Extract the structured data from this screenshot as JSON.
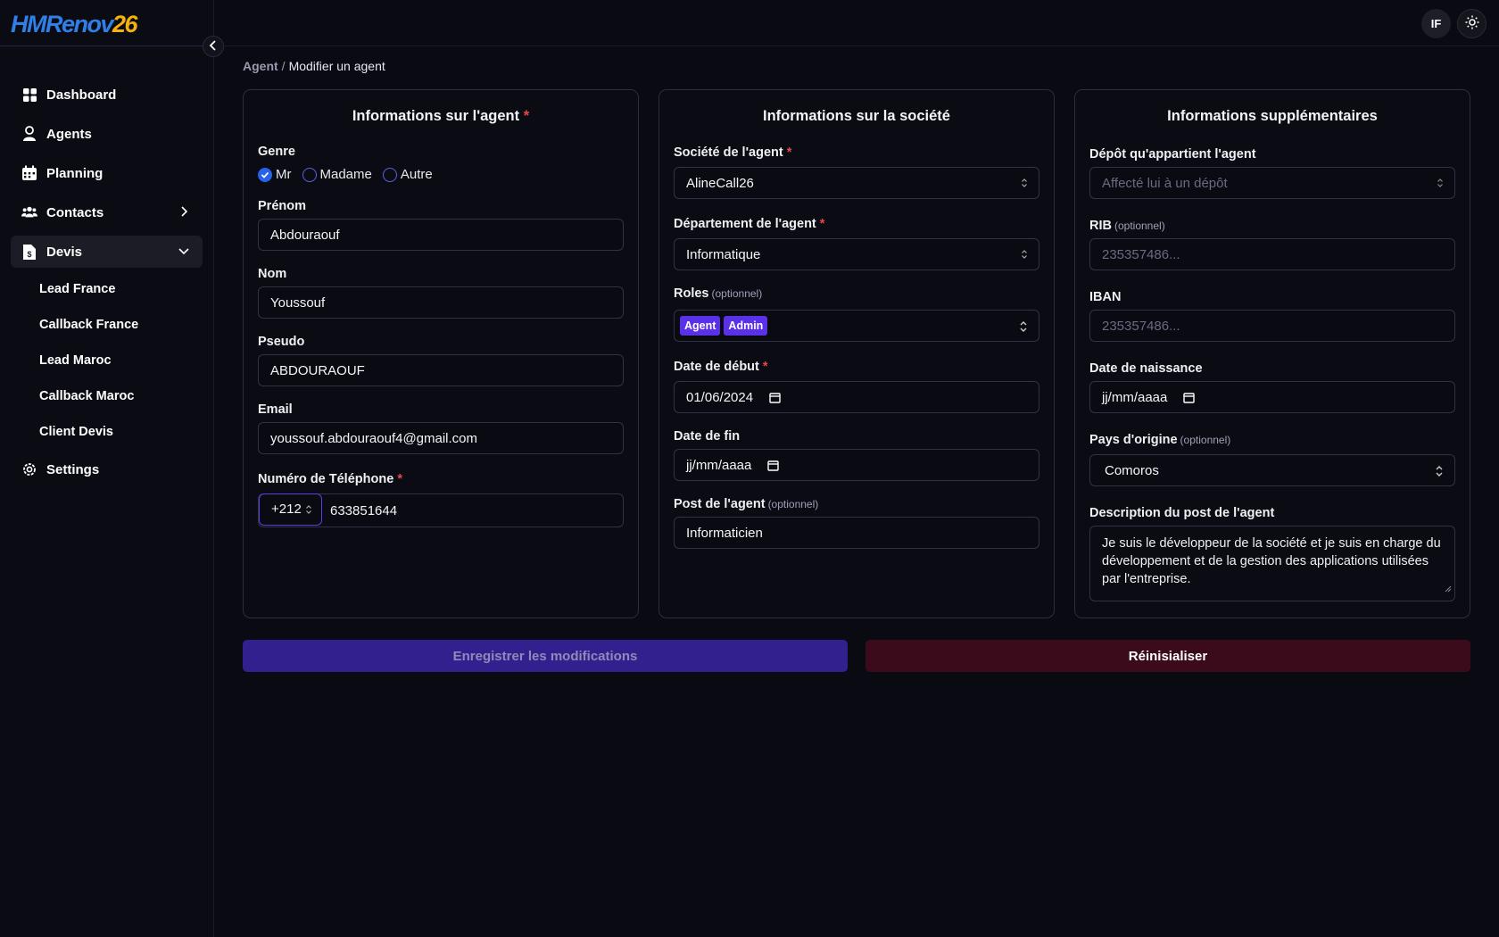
{
  "brand": {
    "logo_text_main": "HMRenov",
    "logo_text_number": "26"
  },
  "sidebar": {
    "items": [
      {
        "label": "Dashboard",
        "icon": "dashboard-icon"
      },
      {
        "label": "Agents",
        "icon": "user-icon"
      },
      {
        "label": "Planning",
        "icon": "calendar-icon"
      },
      {
        "label": "Contacts",
        "icon": "users-icon"
      },
      {
        "label": "Devis",
        "icon": "file-dollar-icon"
      },
      {
        "label": "Settings",
        "icon": "gear-icon"
      }
    ],
    "devis_sub": [
      "Lead France",
      "Callback France",
      "Lead Maroc",
      "Callback Maroc",
      "Client Devis"
    ]
  },
  "topbar": {
    "avatar_initials": "IF"
  },
  "breadcrumb": {
    "parent": "Agent",
    "separator": "/",
    "current": "Modifier un agent"
  },
  "agent_card": {
    "title": "Informations sur l'agent",
    "required_mark": "*",
    "genre_label": "Genre",
    "genre_options": [
      "Mr",
      "Madame",
      "Autre"
    ],
    "genre_selected": "Mr",
    "prenom_label": "Prénom",
    "prenom_value": "Abdouraouf",
    "nom_label": "Nom",
    "nom_value": "Youssouf",
    "pseudo_label": "Pseudo",
    "pseudo_value": "ABDOURAOUF",
    "email_label": "Email",
    "email_value": "youssouf.abdouraouf4@gmail.com",
    "phone_label": "Numéro de Téléphone",
    "phone_prefix": "+212",
    "phone_value": "633851644"
  },
  "company_card": {
    "title": "Informations sur la société",
    "societe_label": "Société de l'agent",
    "societe_value": "AlineCall26",
    "departement_label": "Département de l'agent",
    "departement_value": "Informatique",
    "roles_label": "Roles",
    "optional_text": "(optionnel)",
    "roles": [
      "Agent",
      "Admin"
    ],
    "date_debut_label": "Date de début",
    "date_debut_value": "01/06/2024",
    "date_fin_label": "Date de fin",
    "date_fin_value": "jj/mm/aaaa",
    "post_label": "Post de l'agent",
    "post_value": "Informaticien"
  },
  "extra_card": {
    "title": "Informations supplémentaires",
    "depot_label": "Dépôt qu'appartient l'agent",
    "depot_placeholder": "Affecté lui à un dépôt",
    "rib_label": "RIB",
    "rib_placeholder": "235357486...",
    "iban_label": "IBAN",
    "iban_placeholder": "235357486...",
    "naissance_label": "Date de naissance",
    "naissance_value": "jj/mm/aaaa",
    "pays_label": "Pays d'origine",
    "pays_value": "Comoros",
    "description_label": "Description du post de l'agent",
    "description_value": "Je suis le développeur de la société et je suis en charge du développement et de la gestion des applications utilisées par l'entreprise."
  },
  "actions": {
    "save_label": "Enregistrer les modifications",
    "reset_label": "Réinisialiser"
  },
  "colors": {
    "accent": "#5a31e8",
    "save_bg": "#33208f",
    "reset_bg": "#3b0b1c",
    "required": "#e5484d"
  }
}
